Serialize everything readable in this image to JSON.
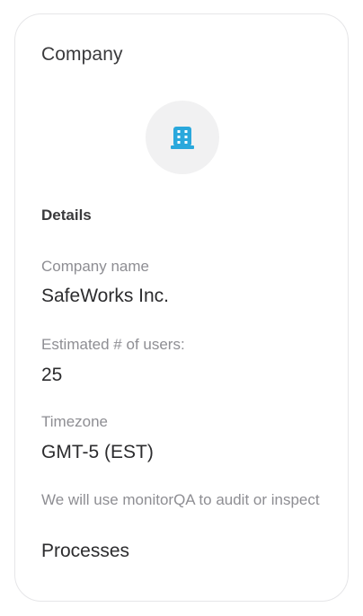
{
  "card": {
    "title": "Company",
    "icon": "building-icon",
    "accent_color": "#2aa8dc"
  },
  "details": {
    "heading": "Details",
    "fields": [
      {
        "label": "Company name",
        "value": "SafeWorks Inc."
      },
      {
        "label": "Estimated # of users:",
        "value": "25"
      },
      {
        "label": "Timezone",
        "value": "GMT-5 (EST)"
      },
      {
        "label": "We will use monitorQA to audit or inspect",
        "value": "Processes"
      }
    ]
  }
}
